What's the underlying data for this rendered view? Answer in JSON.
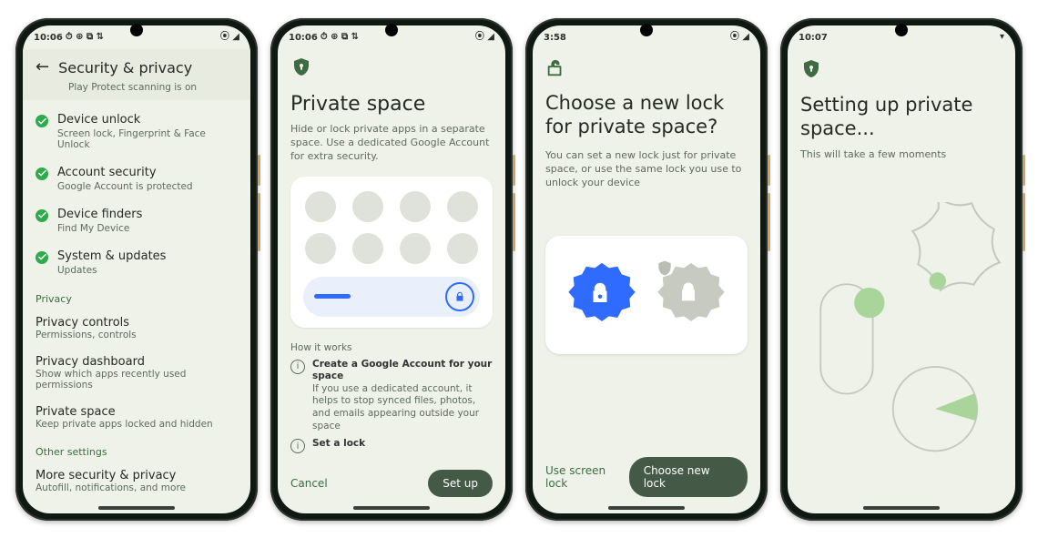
{
  "screens": {
    "s1": {
      "status": {
        "time": "10:06",
        "icons_left": "⏱ ⊕ ⧉ ⇅",
        "icons_right": "⦿ ◢"
      },
      "title": "Security & privacy",
      "play_protect_sub": "Play Protect scanning is on",
      "items": [
        {
          "title": "Device unlock",
          "sub": "Screen lock, Fingerprint & Face Unlock"
        },
        {
          "title": "Account security",
          "sub": "Google Account is protected"
        },
        {
          "title": "Device finders",
          "sub": "Find My Device"
        },
        {
          "title": "System & updates",
          "sub": "Updates"
        }
      ],
      "section_privacy": "Privacy",
      "privacy_items": [
        {
          "title": "Privacy controls",
          "sub": "Permissions, controls"
        },
        {
          "title": "Privacy dashboard",
          "sub": "Show which apps recently used permissions"
        },
        {
          "title": "Private space",
          "sub": "Keep private apps locked and hidden"
        }
      ],
      "section_other": "Other settings",
      "more": {
        "title": "More security & privacy",
        "sub": "Autofill, notifications, and more"
      }
    },
    "s2": {
      "status": {
        "time": "10:06",
        "icons_left": "⏱ ⊕ ⧉ ⇅",
        "icons_right": "⦿ ◢"
      },
      "heading": "Private space",
      "desc": "Hide or lock private apps in a separate space. Use a dedicated Google Account for extra security.",
      "how_label": "How it works",
      "how1_title": "Create a Google Account for your space",
      "how1_body": "If you use a dedicated account, it helps to stop synced files, photos, and emails appearing outside your space",
      "how2_title": "Set a lock",
      "cancel": "Cancel",
      "setup": "Set up"
    },
    "s3": {
      "status": {
        "time": "3:58",
        "icons_right": "⦿ ◢"
      },
      "heading": "Choose a new lock for private space?",
      "desc": "You can set a new lock just for private space, or use the same lock you use to unlock your device",
      "use_lock": "Use screen lock",
      "choose_lock": "Choose new lock"
    },
    "s4": {
      "status": {
        "time": "10:07",
        "icons_right": "▾"
      },
      "heading": "Setting up private space...",
      "desc": "This will take a few moments"
    }
  }
}
